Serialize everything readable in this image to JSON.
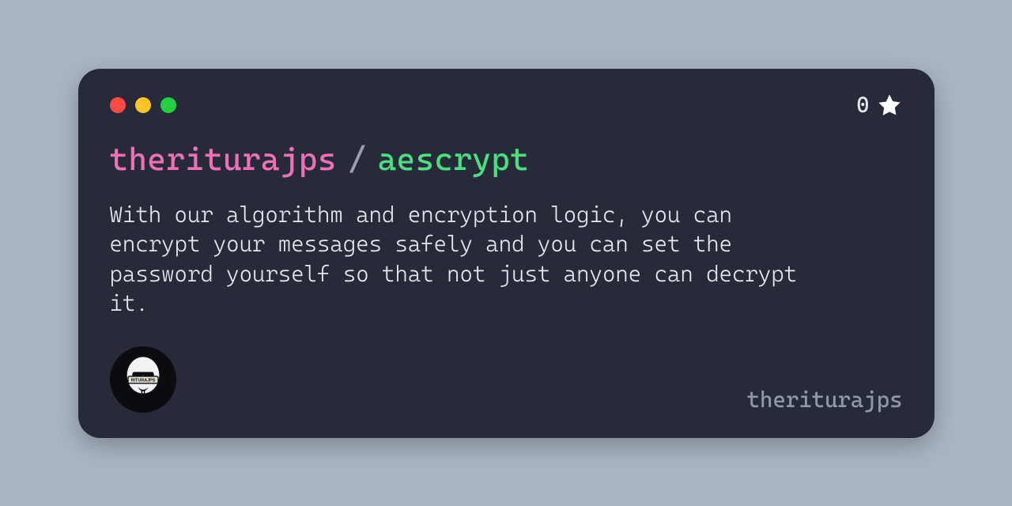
{
  "window": {
    "dot_red": "#ff4a44",
    "dot_yellow": "#ffc326",
    "dot_green": "#24cf43",
    "stars_count": "0"
  },
  "title": {
    "owner": "theriturajps",
    "separator": "/",
    "repo": "aescrypt"
  },
  "description": "With our algorithm and encryption logic, you can encrypt your messages safely and you can set the password yourself so that not just anyone can decrypt it.",
  "footer": {
    "handle": "theriturajps",
    "avatar_label": "RITURAJPS"
  }
}
